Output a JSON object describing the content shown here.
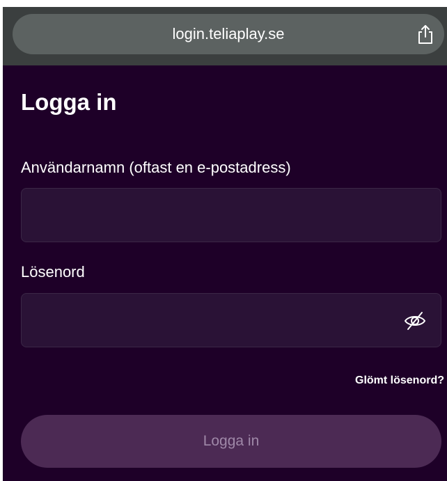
{
  "browser": {
    "url": "login.teliaplay.se",
    "share_icon": "share-icon"
  },
  "page": {
    "title": "Logga in"
  },
  "form": {
    "username_label": "Användarnamn (oftast en e-postadress)",
    "username_value": "",
    "password_label": "Lösenord",
    "password_value": "",
    "password_toggle_icon": "eye-slash-icon",
    "forgot_label": "Glömt lösenord?",
    "submit_label": "Logga in"
  },
  "colors": {
    "background": "#1e0028",
    "field_background": "#2a1236",
    "button_disabled": "#4c2a54",
    "button_text_disabled": "#9f88a8",
    "browser_bar": "#3b3f3f"
  }
}
